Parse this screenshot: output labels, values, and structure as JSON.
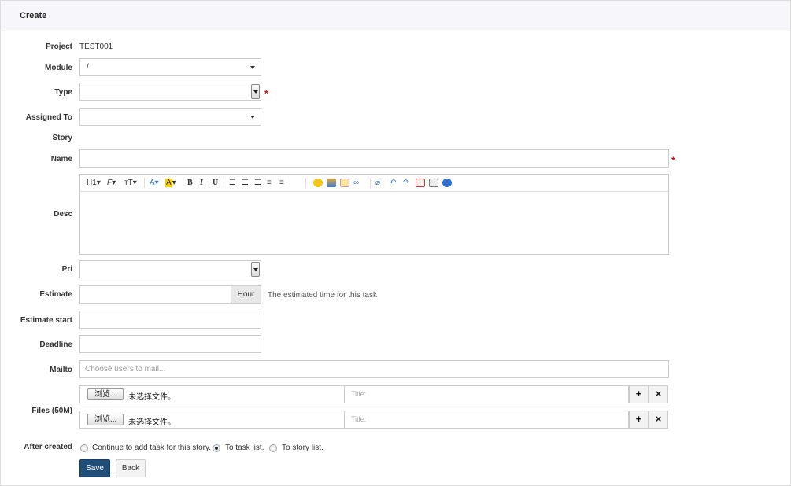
{
  "header": {
    "title": "Create"
  },
  "form": {
    "project": {
      "label": "Project",
      "value": "TEST001"
    },
    "module": {
      "label": "Module",
      "value": "/"
    },
    "type": {
      "label": "Type",
      "value": "",
      "required": "*"
    },
    "assigned_to": {
      "label": "Assigned To",
      "value": ""
    },
    "story": {
      "label": "Story"
    },
    "name": {
      "label": "Name",
      "value": "",
      "required": "*"
    },
    "desc": {
      "label": "Desc",
      "toolbar": {
        "heading": "H1",
        "font_family": "F",
        "font_size": "тT",
        "font_color": "A",
        "bg_color": "A",
        "bold": "B",
        "italic": "I",
        "underline": "U"
      }
    },
    "pri": {
      "label": "Pri",
      "value": ""
    },
    "estimate": {
      "label": "Estimate",
      "value": "",
      "unit": "Hour",
      "hint": "The estimated time for this task"
    },
    "estimate_start": {
      "label": "Estimate start",
      "value": ""
    },
    "deadline": {
      "label": "Deadline",
      "value": ""
    },
    "mailto": {
      "label": "Mailto",
      "placeholder": "Choose users to mail..."
    },
    "files": {
      "label": "Files (50M)",
      "rows": [
        {
          "browse": "浏览...",
          "status": "未选择文件。",
          "title_placeholder": "Title:"
        },
        {
          "browse": "浏览...",
          "status": "未选择文件。",
          "title_placeholder": "Title:"
        }
      ],
      "add_symbol": "+",
      "remove_symbol": "×"
    },
    "after_created": {
      "label": "After created",
      "options": [
        "Continue to add task for this story.",
        "To task list.",
        "To story list."
      ],
      "selected": "To task list."
    },
    "buttons": {
      "save": "Save",
      "back": "Back"
    }
  },
  "colors": {
    "primary": "#1f4e79",
    "required": "#dd0000",
    "header_bg": "#f7f7fb"
  }
}
